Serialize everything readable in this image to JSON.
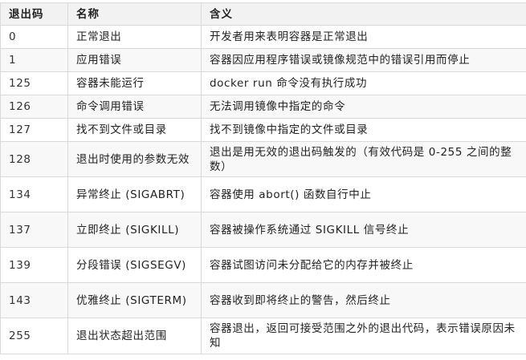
{
  "table": {
    "headers": [
      "退出码",
      "名称",
      "含义"
    ],
    "rows": [
      {
        "code": "0",
        "name": "正常退出",
        "meaning": "开发者用来表明容器是正常退出"
      },
      {
        "code": "1",
        "name": "应用错误",
        "meaning": "容器因应用程序错误或镜像规范中的错误引用而停止"
      },
      {
        "code": "125",
        "name": "容器未能运行",
        "meaning": "docker run 命令没有执行成功"
      },
      {
        "code": "126",
        "name": "命令调用错误",
        "meaning": "无法调用镜像中指定的命令"
      },
      {
        "code": "127",
        "name": "找不到文件或目录",
        "meaning": "找不到镜像中指定的文件或目录"
      },
      {
        "code": "128",
        "name": "退出时使用的参数无效",
        "meaning": "退出是用无效的退出码触发的（有效代码是 0-255 之间的整数）"
      },
      {
        "code": "134",
        "name": "异常终止 (SIGABRT)",
        "meaning": "容器使用 abort() 函数自行中止"
      },
      {
        "code": "137",
        "name": "立即终止 (SIGKILL)",
        "meaning": "容器被操作系统通过 SIGKILL 信号终止"
      },
      {
        "code": "139",
        "name": "分段错误 (SIGSEGV)",
        "meaning": "容器试图访问未分配给它的内存并被终止"
      },
      {
        "code": "143",
        "name": "优雅终止 (SIGTERM)",
        "meaning": "容器收到即将终止的警告，然后终止"
      },
      {
        "code": "255",
        "name": "退出状态超出范围",
        "meaning": "容器退出，返回可接受范围之外的退出代码，表示错误原因未知"
      }
    ]
  }
}
